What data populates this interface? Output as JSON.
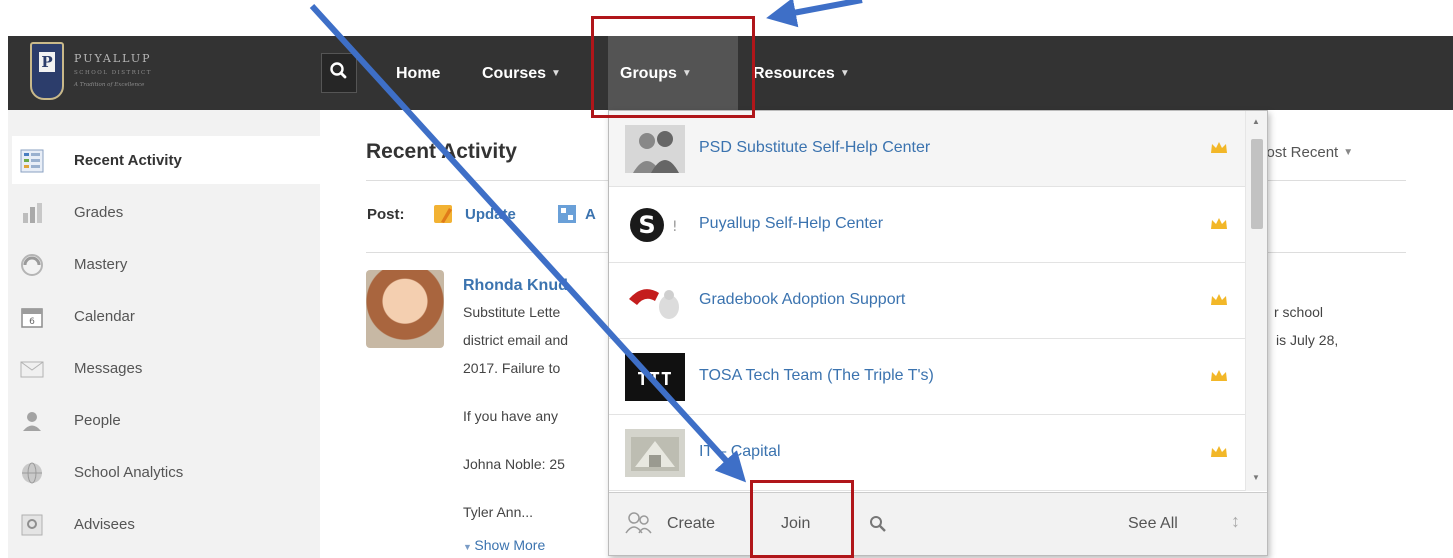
{
  "logo": {
    "letter": "P",
    "name": "PUYALLUP",
    "subtitle": "SCHOOL DISTRICT",
    "tagline": "A Tradition of Excellence"
  },
  "nav": {
    "items": [
      {
        "label": "Home"
      },
      {
        "label": "Courses",
        "has_dropdown": true
      },
      {
        "label": "Groups",
        "has_dropdown": true,
        "active": true
      },
      {
        "label": "Resources",
        "has_dropdown": true
      }
    ]
  },
  "sidebar": {
    "items": [
      {
        "label": "Recent Activity",
        "icon": "recent-activity-icon",
        "active": true
      },
      {
        "label": "Grades",
        "icon": "grades-icon"
      },
      {
        "label": "Mastery",
        "icon": "mastery-icon"
      },
      {
        "label": "Calendar",
        "icon": "calendar-icon",
        "badge": "6"
      },
      {
        "label": "Messages",
        "icon": "envelope-icon"
      },
      {
        "label": "People",
        "icon": "person-icon"
      },
      {
        "label": "School Analytics",
        "icon": "globe-icon"
      },
      {
        "label": "Advisees",
        "icon": "advisees-icon"
      }
    ]
  },
  "main": {
    "title": "Recent Activity",
    "sort_label": "Most Recent",
    "post_label": "Post:",
    "post_buttons": [
      {
        "label": "Update",
        "icon": "update-icon"
      },
      {
        "label": "A",
        "icon": "assignment-icon"
      }
    ],
    "post": {
      "author": "Rhonda Knud",
      "lines": [
        "Substitute Lette",
        "district email and",
        "2017.  Failure to",
        "If you have any",
        "Johna Noble: 25",
        "Tyler Ann..."
      ],
      "right_lines": [
        "r school",
        "is July 28,"
      ],
      "show_more": "Show More"
    }
  },
  "groups_dropdown": {
    "items": [
      {
        "name": "PSD Substitute Self-Help Center",
        "thumb": "silhouette-avatar-icon",
        "admin": true
      },
      {
        "name": "Puyallup Self-Help Center",
        "thumb": "schoology-s-logo-icon",
        "admin": true
      },
      {
        "name": "Gradebook Adoption Support",
        "thumb": "red-phone-icon",
        "admin": true
      },
      {
        "name": "TOSA Tech Team (The Triple T's)",
        "thumb": "ttt-logo-icon",
        "admin": true
      },
      {
        "name": "IT – Capital",
        "thumb": "capital-photo-icon",
        "admin": true
      }
    ],
    "footer": {
      "create": "Create",
      "join": "Join",
      "see_all": "See All"
    }
  },
  "colors": {
    "topbar": "#333333",
    "active_nav": "#545454",
    "link": "#3b73af",
    "annotation_red": "#b0161a",
    "annotation_arrow": "#3e6fc7"
  }
}
